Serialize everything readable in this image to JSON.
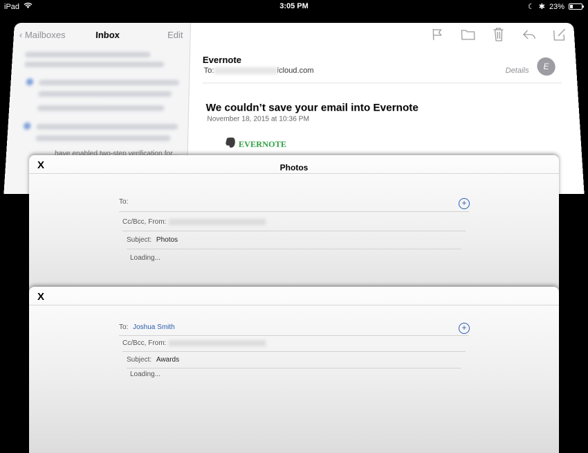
{
  "status_bar": {
    "device": "iPad",
    "time": "3:05 PM",
    "battery": "23%",
    "battery_level": 0.23
  },
  "mail": {
    "nav": {
      "back_label": "Mailboxes",
      "title": "Inbox",
      "edit_label": "Edit"
    },
    "list_snippet": "have enabled two-step verification for...",
    "message": {
      "sender": "Evernote",
      "to_label": "To:",
      "to_domain": "icloud.com",
      "details_label": "Details",
      "avatar_initial": "E",
      "subject": "We couldn’t save your email into Evernote",
      "date": "November 18, 2015 at 10:36 PM",
      "logo_text": "EVERNOTE"
    },
    "toolbar": [
      "flag-icon",
      "folder-icon",
      "trash-icon",
      "reply-icon",
      "compose-icon"
    ]
  },
  "compose_cards": [
    {
      "title": "Photos",
      "close": "X",
      "to_label": "To:",
      "to_value": "",
      "ccbcc_label": "Cc/Bcc, From:",
      "subject_label": "Subject:",
      "subject_value": "Photos",
      "body": "Loading..."
    },
    {
      "title": "",
      "close": "X",
      "to_label": "To:",
      "to_value": "Joshua Smith",
      "ccbcc_label": "Cc/Bcc, From:",
      "subject_label": "Subject:",
      "subject_value": "Awards",
      "body": "Loading..."
    }
  ],
  "colors": {
    "accent": "#2a5db0",
    "evernote_green": "#2e9e44"
  }
}
